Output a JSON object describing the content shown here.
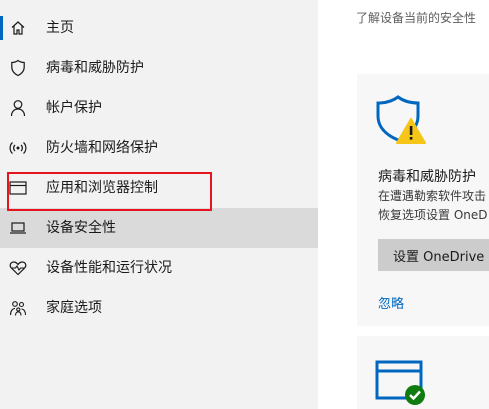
{
  "sidebar": {
    "items": [
      {
        "label": "主页",
        "icon": "home-icon"
      },
      {
        "label": "病毒和威胁防护",
        "icon": "shield-icon"
      },
      {
        "label": "帐户保护",
        "icon": "person-icon"
      },
      {
        "label": "防火墙和网络保护",
        "icon": "wifi-icon"
      },
      {
        "label": "应用和浏览器控制",
        "icon": "browser-window-icon"
      },
      {
        "label": "设备安全性",
        "icon": "laptop-icon"
      },
      {
        "label": "设备性能和运行状况",
        "icon": "heart-icon"
      },
      {
        "label": "家庭选项",
        "icon": "family-icon"
      }
    ],
    "selected_index": 5,
    "highlighted_index": 4
  },
  "main": {
    "intro": "了解设备当前的安全性",
    "cards": [
      {
        "icon": "shield-warning-icon",
        "title": "病毒和威胁防护",
        "desc_line1": "在遭遇勒索软件攻击",
        "desc_line2": "恢复选项设置 OneD",
        "button": "设置 OneDrive",
        "link": "忽略"
      },
      {
        "icon": "browser-check-icon"
      }
    ]
  },
  "colors": {
    "accent": "#0067c0",
    "highlight_box": "#e6141e",
    "warning": "#f5c518",
    "ok": "#107c10"
  }
}
